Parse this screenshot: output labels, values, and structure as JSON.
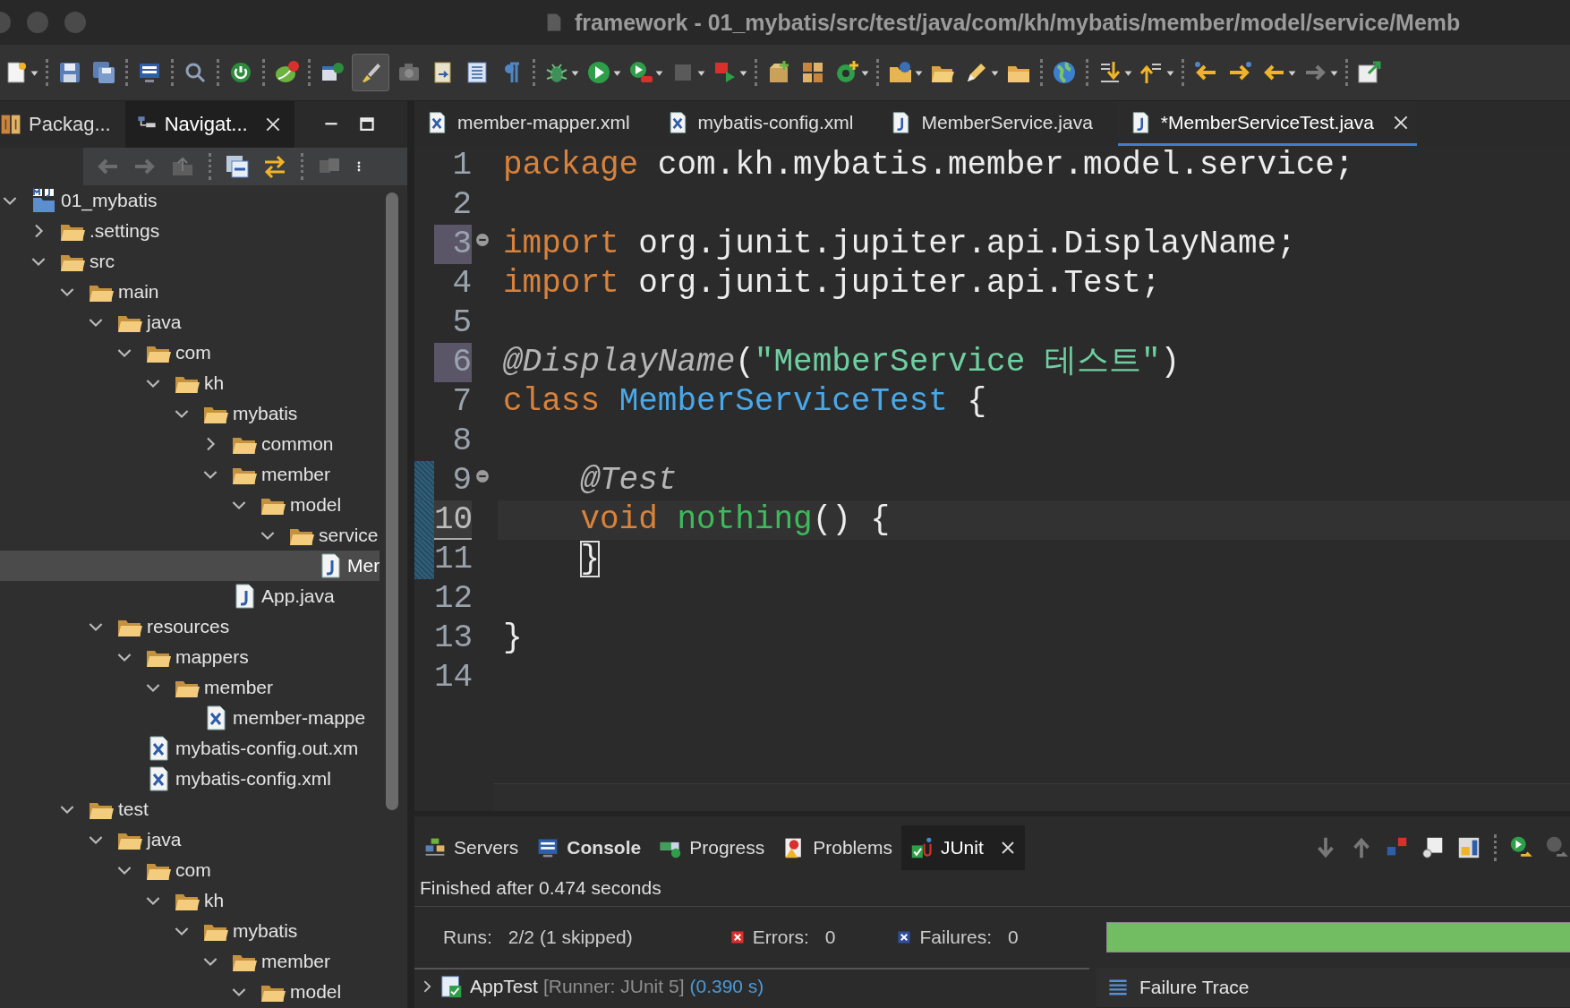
{
  "window": {
    "title": "framework - 01_mybatis/src/test/java/com/kh/mybatis/member/model/service/Memb"
  },
  "left_panel": {
    "tabs": [
      {
        "label": "Packag...",
        "selected": false,
        "closable": false
      },
      {
        "label": "Navigat...",
        "selected": true,
        "closable": true
      }
    ],
    "tree": [
      {
        "label": "01_mybatis",
        "kind": "project",
        "expanded": true,
        "selected": false,
        "children": [
          {
            "label": ".settings",
            "kind": "folder",
            "expanded": false,
            "selected": false
          },
          {
            "label": "src",
            "kind": "folder",
            "expanded": true,
            "selected": false,
            "children": [
              {
                "label": "main",
                "kind": "folder",
                "expanded": true,
                "selected": false,
                "children": [
                  {
                    "label": "java",
                    "kind": "folder",
                    "expanded": true,
                    "selected": false,
                    "children": [
                      {
                        "label": "com",
                        "kind": "folder",
                        "expanded": true,
                        "selected": false,
                        "children": [
                          {
                            "label": "kh",
                            "kind": "folder",
                            "expanded": true,
                            "selected": false,
                            "children": [
                              {
                                "label": "mybatis",
                                "kind": "folder",
                                "expanded": true,
                                "selected": false,
                                "children": [
                                  {
                                    "label": "common",
                                    "kind": "folder",
                                    "expanded": false,
                                    "selected": false
                                  },
                                  {
                                    "label": "member",
                                    "kind": "folder",
                                    "expanded": true,
                                    "selected": false,
                                    "children": [
                                      {
                                        "label": "model",
                                        "kind": "folder",
                                        "expanded": true,
                                        "selected": false,
                                        "children": [
                                          {
                                            "label": "service",
                                            "kind": "folder",
                                            "expanded": true,
                                            "selected": false,
                                            "children": [
                                              {
                                                "label": "Mer",
                                                "kind": "java",
                                                "selected": true
                                              }
                                            ]
                                          }
                                        ]
                                      }
                                    ]
                                  },
                                  {
                                    "label": "App.java",
                                    "kind": "java",
                                    "selected": false
                                  }
                                ]
                              }
                            ]
                          }
                        ]
                      }
                    ]
                  },
                  {
                    "label": "resources",
                    "kind": "folder",
                    "expanded": true,
                    "selected": false,
                    "children": [
                      {
                        "label": "mappers",
                        "kind": "folder",
                        "expanded": true,
                        "selected": false,
                        "children": [
                          {
                            "label": "member",
                            "kind": "folder",
                            "expanded": true,
                            "selected": false,
                            "children": [
                              {
                                "label": "member-mappe",
                                "kind": "xml",
                                "selected": false
                              }
                            ]
                          }
                        ]
                      },
                      {
                        "label": "mybatis-config.out.xm",
                        "kind": "xml",
                        "selected": false
                      },
                      {
                        "label": "mybatis-config.xml",
                        "kind": "xml",
                        "selected": false
                      }
                    ]
                  }
                ]
              },
              {
                "label": "test",
                "kind": "folder",
                "expanded": true,
                "selected": false,
                "children": [
                  {
                    "label": "java",
                    "kind": "folder",
                    "expanded": true,
                    "selected": false,
                    "children": [
                      {
                        "label": "com",
                        "kind": "folder",
                        "expanded": true,
                        "selected": false,
                        "children": [
                          {
                            "label": "kh",
                            "kind": "folder",
                            "expanded": true,
                            "selected": false,
                            "children": [
                              {
                                "label": "mybatis",
                                "kind": "folder",
                                "expanded": true,
                                "selected": false,
                                "children": [
                                  {
                                    "label": "member",
                                    "kind": "folder",
                                    "expanded": true,
                                    "selected": false,
                                    "children": [
                                      {
                                        "label": "model",
                                        "kind": "folder",
                                        "expanded": true,
                                        "selected": false
                                      }
                                    ]
                                  }
                                ]
                              }
                            ]
                          }
                        ]
                      }
                    ]
                  }
                ]
              }
            ]
          }
        ]
      }
    ]
  },
  "editor": {
    "tabs": [
      {
        "label": "member-mapper.xml",
        "kind": "xml",
        "selected": false,
        "closable": false
      },
      {
        "label": "mybatis-config.xml",
        "kind": "xml",
        "selected": false,
        "closable": false
      },
      {
        "label": "MemberService.java",
        "kind": "java",
        "selected": false,
        "closable": false
      },
      {
        "label": "*MemberServiceTest.java",
        "kind": "java",
        "selected": true,
        "closable": true
      }
    ],
    "lines": [
      {
        "number": "1",
        "marked": false,
        "fold": false,
        "current": false,
        "changed": false,
        "tokens": [
          {
            "kind": "keyword",
            "text": "package"
          },
          {
            "kind": "plain",
            "text": " com.kh.mybatis.member.model.service;"
          }
        ]
      },
      {
        "number": "2",
        "marked": false,
        "fold": false,
        "current": false,
        "changed": false
      },
      {
        "number": "3",
        "marked": true,
        "fold": true,
        "current": false,
        "changed": false,
        "tokens": [
          {
            "kind": "keyword",
            "text": "import"
          },
          {
            "kind": "plain",
            "text": " org.junit.jupiter.api.DisplayName;"
          }
        ]
      },
      {
        "number": "4",
        "marked": false,
        "fold": false,
        "current": false,
        "changed": false,
        "tokens": [
          {
            "kind": "keyword",
            "text": "import"
          },
          {
            "kind": "plain",
            "text": " org.junit.jupiter.api.Test;"
          }
        ]
      },
      {
        "number": "5",
        "marked": false,
        "fold": false,
        "current": false,
        "changed": false
      },
      {
        "number": "6",
        "marked": true,
        "fold": false,
        "current": false,
        "changed": false,
        "tokens": [
          {
            "kind": "annotation",
            "text": "@DisplayName"
          },
          {
            "kind": "plain",
            "text": "("
          },
          {
            "kind": "string",
            "text": "\"MemberService 테스트\""
          },
          {
            "kind": "plain",
            "text": ")"
          }
        ]
      },
      {
        "number": "7",
        "marked": false,
        "fold": false,
        "current": false,
        "changed": false,
        "tokens": [
          {
            "kind": "keyword",
            "text": "class "
          },
          {
            "kind": "type",
            "text": "MemberServiceTest"
          },
          {
            "kind": "plain",
            "text": " {"
          }
        ]
      },
      {
        "number": "8",
        "marked": false,
        "fold": false,
        "current": false,
        "changed": false
      },
      {
        "number": "9",
        "marked": false,
        "fold": true,
        "current": false,
        "changed": true,
        "tokens": [
          {
            "kind": "annotation",
            "text": "    @Test"
          }
        ]
      },
      {
        "number": "10",
        "marked": false,
        "fold": false,
        "current": true,
        "changed": true,
        "tokens": [
          {
            "kind": "keyword",
            "text": "    void "
          },
          {
            "kind": "method",
            "text": "nothing"
          },
          {
            "kind": "plain",
            "text": "() {"
          }
        ]
      },
      {
        "number": "11",
        "marked": false,
        "fold": false,
        "current": false,
        "changed": true,
        "tokens": [
          {
            "kind": "match",
            "text": "    }"
          }
        ]
      },
      {
        "number": "12",
        "marked": false,
        "fold": false,
        "current": false,
        "changed": false
      },
      {
        "number": "13",
        "marked": false,
        "fold": false,
        "current": false,
        "changed": false,
        "tokens": [
          {
            "kind": "plain",
            "text": "}"
          }
        ]
      },
      {
        "number": "14",
        "marked": false,
        "fold": false,
        "current": false,
        "changed": false
      }
    ]
  },
  "bottom_panel": {
    "tabs": [
      {
        "label": "Servers",
        "kind": "servers",
        "selected": false,
        "emphasized": false,
        "closable": false
      },
      {
        "label": "Console",
        "kind": "console",
        "selected": false,
        "emphasized": true,
        "closable": false
      },
      {
        "label": "Progress",
        "kind": "progress",
        "selected": false,
        "emphasized": false,
        "closable": false
      },
      {
        "label": "Problems",
        "kind": "problems",
        "selected": false,
        "emphasized": false,
        "closable": false
      },
      {
        "label": "JUnit",
        "kind": "junit",
        "selected": true,
        "emphasized": false,
        "closable": true
      }
    ],
    "status": "Finished after 0.474 seconds",
    "counters": [
      {
        "kind": "runs",
        "label": "Runs:",
        "value": "2/2 (1 skipped)"
      },
      {
        "kind": "errors",
        "label": "Errors:",
        "value": "0"
      },
      {
        "kind": "failures",
        "label": "Failures:",
        "value": "0"
      }
    ],
    "progress": {
      "level": 1
    },
    "results": [
      {
        "name": "AppTest",
        "runner": "[Runner: JUnit 5]",
        "time": "(0.390 s)",
        "expanded": false
      }
    ],
    "failure_trace": {
      "title": "Failure Trace"
    }
  }
}
